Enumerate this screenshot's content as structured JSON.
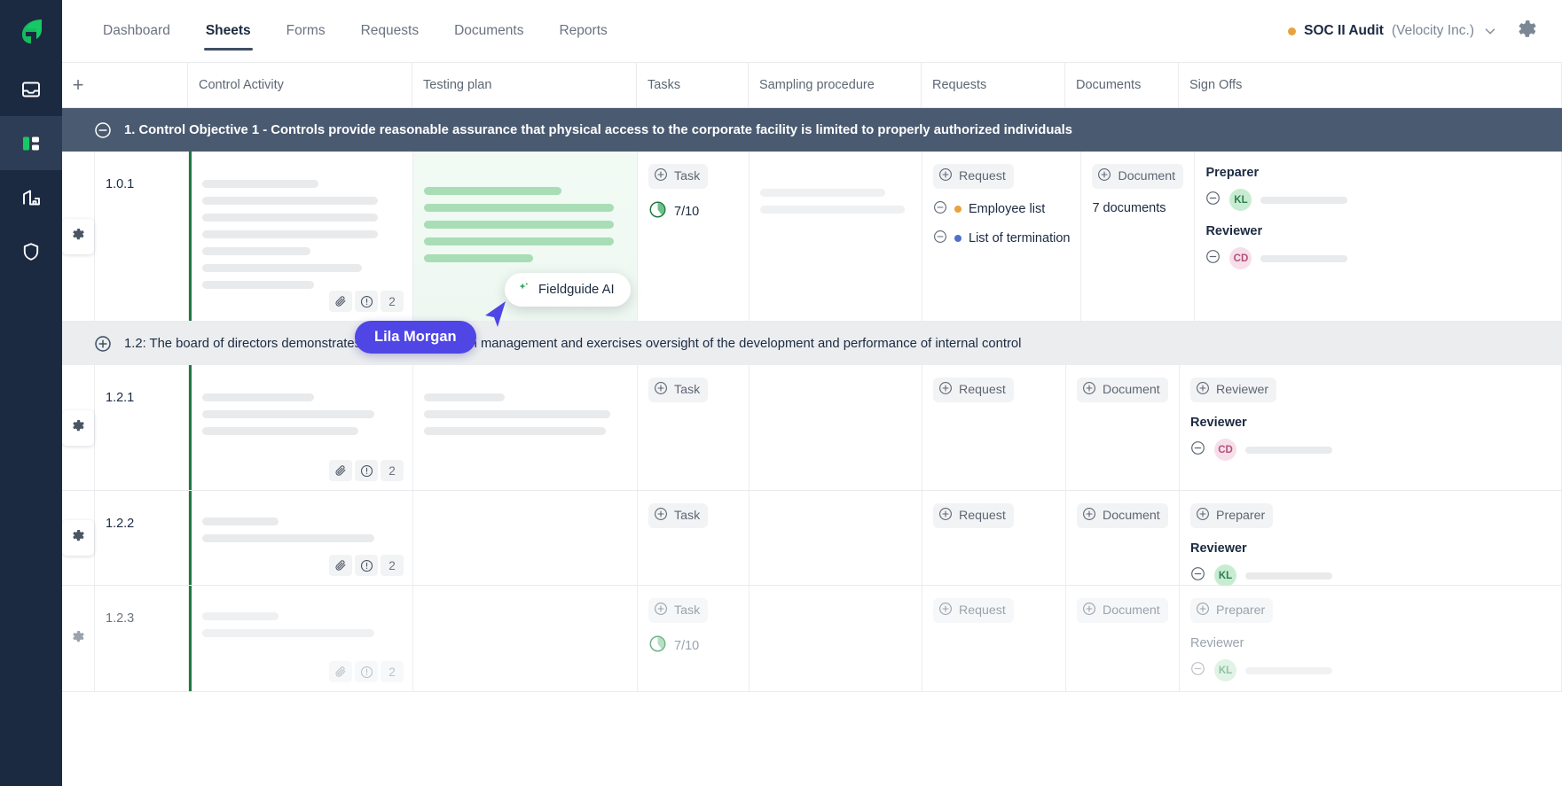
{
  "sidebar": {
    "logo": "fieldguide-logo",
    "items": [
      {
        "name": "inbox-icon",
        "label": "Inbox",
        "active": false
      },
      {
        "name": "sheets-icon",
        "label": "Sheets",
        "active": true
      },
      {
        "name": "building-icon",
        "label": "Engagements",
        "active": false
      },
      {
        "name": "shield-icon",
        "label": "Security",
        "active": false
      }
    ]
  },
  "header": {
    "tabs": [
      {
        "label": "Dashboard",
        "active": false
      },
      {
        "label": "Sheets",
        "active": true
      },
      {
        "label": "Forms",
        "active": false
      },
      {
        "label": "Requests",
        "active": false
      },
      {
        "label": "Documents",
        "active": false
      },
      {
        "label": "Reports",
        "active": false
      }
    ],
    "project": {
      "status_color": "#e8a33d",
      "name": "SOC II Audit",
      "org": "(Velocity Inc.)",
      "chevron": "chevron-down-icon"
    },
    "settings_icon": "gear-icon"
  },
  "grid": {
    "add_column": "+",
    "columns": [
      {
        "label": ""
      },
      {
        "label": "Control Activity"
      },
      {
        "label": "Testing plan"
      },
      {
        "label": "Tasks"
      },
      {
        "label": "Sampling procedure"
      },
      {
        "label": "Requests"
      },
      {
        "label": "Documents"
      },
      {
        "label": "Sign Offs"
      }
    ],
    "groups": [
      {
        "id": "group-1",
        "expanded": true,
        "toggle_icon": "minus-circle-icon",
        "title": "1. Control Objective 1 - Controls provide reasonable assurance that physical access to the corporate facility is limited to properly authorized individuals",
        "style": "dark"
      },
      {
        "id": "group-2",
        "expanded": false,
        "toggle_icon": "plus-circle-icon",
        "title": "1.2: The board of directors demonstrates independence from management and exercises oversight of the development and performance of internal control",
        "style": "light"
      }
    ],
    "rows": [
      {
        "id": "1.0.1",
        "number": "1.0.1",
        "gear": "gear-icon",
        "control_activity_tools": {
          "attachment": "paperclip-icon",
          "issue": "exclamation-circle-icon",
          "count": "2"
        },
        "testing_plan_ai": true,
        "tasks": {
          "add_label": "Task",
          "progress_label": "7/10",
          "progress_value": 7,
          "progress_total": 10
        },
        "requests": {
          "add_label": "Request",
          "items": [
            {
              "label": "Employee list",
              "dot_color": "#e8a33d",
              "toggle": "minus-circle-icon"
            },
            {
              "label": "List of termination",
              "dot_color": "#4f6fd1",
              "toggle": "minus-circle-icon"
            }
          ]
        },
        "documents": {
          "add_label": "Document",
          "summary": "7 documents"
        },
        "signoffs": {
          "roles": [
            {
              "role": "Preparer",
              "avatar": "KL",
              "avatar_bg": "#c8ecd1",
              "avatar_fg": "#2e7d4f",
              "toggle": "minus-circle-icon"
            },
            {
              "role": "Reviewer",
              "avatar": "CD",
              "avatar_bg": "#f7dfe9",
              "avatar_fg": "#b3517c",
              "toggle": "minus-circle-icon"
            }
          ]
        }
      },
      {
        "id": "1.2.1",
        "number": "1.2.1",
        "gear": "gear-icon",
        "control_activity_tools": {
          "attachment": "paperclip-icon",
          "issue": "exclamation-circle-icon",
          "count": "2"
        },
        "testing_plan_ai": false,
        "tasks": {
          "add_label": "Task"
        },
        "requests": {
          "add_label": "Request",
          "items": []
        },
        "documents": {
          "add_label": "Document"
        },
        "signoffs": {
          "add_label": "Reviewer",
          "roles": [
            {
              "role": "Reviewer",
              "avatar": "CD",
              "avatar_bg": "#f7dfe9",
              "avatar_fg": "#b3517c",
              "toggle": "minus-circle-icon"
            }
          ]
        }
      },
      {
        "id": "1.2.2",
        "number": "1.2.2",
        "gear": "gear-icon",
        "control_activity_tools": {
          "attachment": "paperclip-icon",
          "issue": "exclamation-circle-icon",
          "count": "2"
        },
        "testing_plan_ai": false,
        "tasks": {
          "add_label": "Task"
        },
        "requests": {
          "add_label": "Request",
          "items": []
        },
        "documents": {
          "add_label": "Document"
        },
        "signoffs": {
          "add_label": "Preparer",
          "roles": [
            {
              "role": "Reviewer",
              "avatar": "KL",
              "avatar_bg": "#c8ecd1",
              "avatar_fg": "#2e7d4f",
              "toggle": "minus-circle-icon"
            }
          ]
        }
      },
      {
        "id": "1.2.3",
        "number": "1.2.3",
        "gear": "gear-icon",
        "control_activity_tools": {
          "attachment": "paperclip-icon",
          "issue": "exclamation-circle-icon",
          "count": "2"
        },
        "testing_plan_ai": false,
        "tasks": {
          "add_label": "Task",
          "progress_label": "7/10",
          "progress_value": 7,
          "progress_total": 10
        },
        "requests": {
          "add_label": "Request",
          "items": []
        },
        "documents": {
          "add_label": "Document"
        },
        "signoffs": {
          "add_label": "Preparer",
          "roles": [
            {
              "role": "Reviewer",
              "avatar": "KL",
              "avatar_bg": "#cfeed8",
              "avatar_fg": "#6fb386",
              "toggle": "minus-circle-icon"
            }
          ]
        }
      }
    ]
  },
  "overlays": {
    "ai_pill": {
      "label": "Fieldguide AI",
      "icon": "sparkle-icon",
      "icon_color": "#2fa85a"
    },
    "cursor": {
      "name": "Lila Morgan",
      "color": "#4f46e5"
    }
  }
}
